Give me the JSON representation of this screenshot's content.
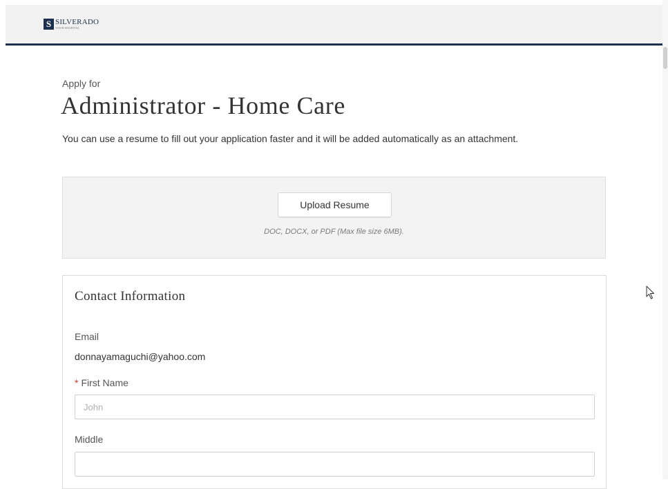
{
  "header": {
    "logo_letter": "S",
    "logo_name": "SILVERADO",
    "logo_tagline": "YOUR HOSPITAL"
  },
  "page": {
    "apply_for": "Apply for",
    "job_title": "Administrator - Home Care",
    "intro": "You can use a resume to fill out your application faster and it will be added automatically as an attachment."
  },
  "upload": {
    "button_label": "Upload Resume",
    "hint": "DOC, DOCX, or PDF (Max file size 6MB)."
  },
  "contact": {
    "title": "Contact Information",
    "email_label": "Email",
    "email_value": "donnayamaguchi@yahoo.com",
    "required_marker": "*",
    "first_name_label": "First Name",
    "first_name_placeholder": "John",
    "first_name_value": "",
    "middle_label": "Middle",
    "middle_value": ""
  },
  "colors": {
    "brand_navy": "#1d2f4e",
    "required_red": "#c0392b",
    "panel_gray": "#f3f3f3"
  }
}
